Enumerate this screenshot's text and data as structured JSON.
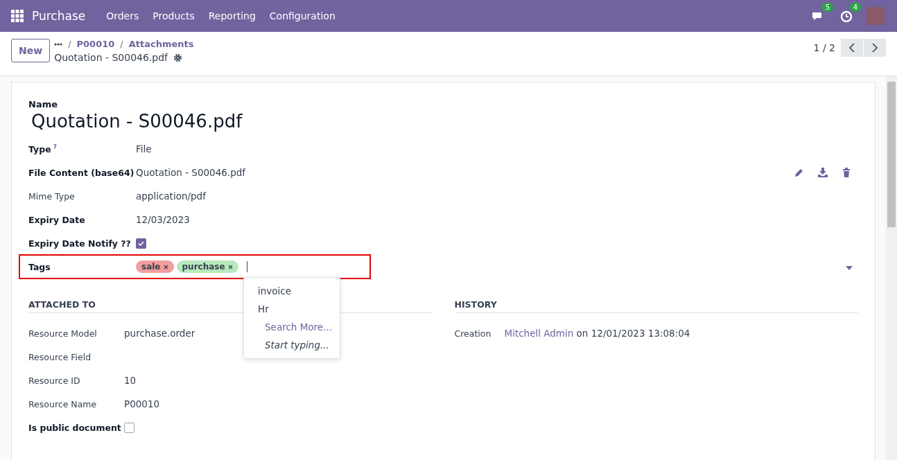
{
  "navbar": {
    "app": "Purchase",
    "menus": [
      "Orders",
      "Products",
      "Reporting",
      "Configuration"
    ],
    "messages_count": "5",
    "activities_count": "4"
  },
  "control_panel": {
    "new_button": "New",
    "breadcrumb_separator": "/",
    "breadcrumbs": [
      "P00010",
      "Attachments"
    ],
    "record_title": "Quotation - S00046.pdf",
    "pager": "1 / 2"
  },
  "form": {
    "name_label": "Name",
    "name_value": "Quotation - S00046.pdf",
    "fields": [
      {
        "kind": "text",
        "label": "Type",
        "help": "?",
        "value": "File",
        "emphasized": true
      },
      {
        "kind": "file",
        "label": "File Content (base64)",
        "value": "Quotation - S00046.pdf",
        "emphasized": true
      },
      {
        "kind": "text",
        "label": "Mime Type",
        "value": "application/pdf",
        "emphasized": false
      },
      {
        "kind": "text",
        "label": "Expiry Date",
        "value": "12/03/2023",
        "emphasized": true
      },
      {
        "kind": "checkbox",
        "label": "Expiry Date Notify ??",
        "checked": true,
        "emphasized": true
      },
      {
        "kind": "tags",
        "label": "Tags",
        "emphasized": true,
        "highlighted": true,
        "tags": [
          {
            "label": "sale",
            "color": "#f29e9e"
          },
          {
            "label": "purchase",
            "color": "#b7e9bd"
          }
        ],
        "dropdown": [
          {
            "kind": "option",
            "label": "invoice"
          },
          {
            "kind": "option",
            "label": "Hr"
          },
          {
            "kind": "action",
            "label": "Search More..."
          },
          {
            "kind": "hint",
            "label": "Start typing..."
          }
        ]
      }
    ],
    "attached_to": {
      "title": "ATTACHED TO",
      "fields": [
        {
          "kind": "text",
          "label": "Resource Model",
          "value": "purchase.order",
          "emphasized": false
        },
        {
          "kind": "text",
          "label": "Resource Field",
          "emphasized": false
        },
        {
          "kind": "text",
          "label": "Resource ID",
          "value": "10",
          "emphasized": false
        },
        {
          "kind": "text",
          "label": "Resource Name",
          "value": "P00010",
          "emphasized": false
        },
        {
          "kind": "checkbox",
          "label": "Is public document",
          "checked": false,
          "emphasized": true
        }
      ]
    },
    "history": {
      "title": "HISTORY",
      "label": "Creation",
      "author": "Mitchell Admin",
      "date_text": "on 12/01/2023 13:08:04"
    }
  }
}
